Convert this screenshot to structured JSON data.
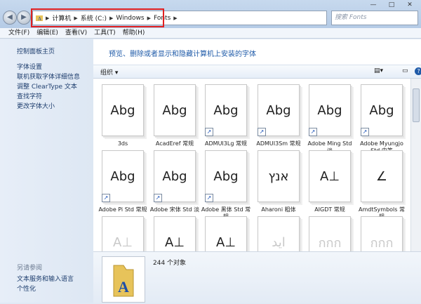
{
  "window": {
    "minimize": "—",
    "maximize": "□",
    "close": "✕"
  },
  "address": {
    "root_icon": "fonts-folder-icon",
    "crumbs": [
      "计算机",
      "系统 (C:)",
      "Windows",
      "Fonts"
    ],
    "separator": "▶"
  },
  "search": {
    "placeholder": "搜索 Fonts"
  },
  "menu": [
    "文件(F)",
    "编辑(E)",
    "查看(V)",
    "工具(T)",
    "帮助(H)"
  ],
  "sidebar": {
    "home": "控制面板主页",
    "links": [
      "字体设置",
      "联机获取字体详细信息",
      "调整 ClearType 文本",
      "查找字符",
      "更改字体大小"
    ],
    "see_also_title": "另请参阅",
    "see_also": [
      "文本服务和输入语言",
      "个性化"
    ]
  },
  "content": {
    "title": "预览、删除或者显示和隐藏计算机上安装的字体"
  },
  "toolbar": {
    "organize": "组织 ▾"
  },
  "fonts": [
    {
      "preview": "Abg",
      "label": "3ds",
      "stack": true,
      "shortcut": false,
      "faint": false
    },
    {
      "preview": "Abg",
      "label": "AcadEref 常规",
      "stack": false,
      "shortcut": false,
      "faint": false
    },
    {
      "preview": "Abg",
      "label": "ADMUI3Lg 常规",
      "stack": false,
      "shortcut": true,
      "faint": false
    },
    {
      "preview": "Abg",
      "label": "ADMUI3Sm 常规",
      "stack": false,
      "shortcut": true,
      "faint": false
    },
    {
      "preview": "Abg",
      "label": "Adobe Ming Std 淡",
      "stack": false,
      "shortcut": true,
      "faint": false
    },
    {
      "preview": "Abg",
      "label": "Adobe Myungjo Std 中等",
      "stack": false,
      "shortcut": true,
      "faint": false
    },
    {
      "preview": "Abg",
      "label": "Adobe Pi Std 常规",
      "stack": false,
      "shortcut": true,
      "faint": false
    },
    {
      "preview": "Abg",
      "label": "Adobe 宋体 Std 淡",
      "stack": false,
      "shortcut": true,
      "faint": false
    },
    {
      "preview": "Abg",
      "label": "Adobe 黑体 Std 常规",
      "stack": false,
      "shortcut": true,
      "faint": false
    },
    {
      "preview": "אנץ",
      "label": "Aharoni 粗体",
      "stack": false,
      "shortcut": false,
      "faint": false
    },
    {
      "preview": "A⊥",
      "label": "AIGDT 常规",
      "stack": false,
      "shortcut": false,
      "faint": false
    },
    {
      "preview": "∠",
      "label": "AmdtSymbols 常规",
      "stack": false,
      "shortcut": false,
      "faint": false
    },
    {
      "preview": "A⊥",
      "label": "",
      "stack": true,
      "shortcut": false,
      "faint": true
    },
    {
      "preview": "A⊥",
      "label": "",
      "stack": false,
      "shortcut": false,
      "faint": false
    },
    {
      "preview": "A⊥",
      "label": "",
      "stack": false,
      "shortcut": false,
      "faint": false
    },
    {
      "preview": "ايد",
      "label": "",
      "stack": false,
      "shortcut": false,
      "faint": true
    },
    {
      "preview": "กกก",
      "label": "",
      "stack": true,
      "shortcut": false,
      "faint": true
    },
    {
      "preview": "กกก",
      "label": "",
      "stack": true,
      "shortcut": false,
      "faint": true
    }
  ],
  "details": {
    "count": "244 个对象"
  }
}
